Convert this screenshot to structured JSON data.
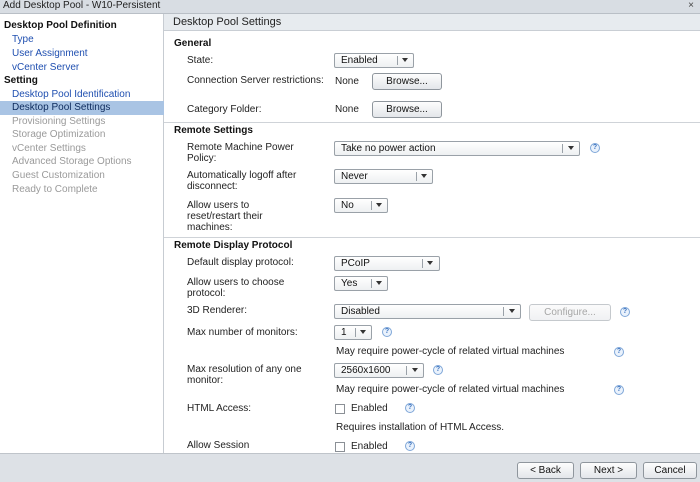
{
  "window": {
    "title": "Add Desktop Pool - W10-Persistent",
    "close": "×"
  },
  "sidebar": {
    "items": [
      {
        "label": "Desktop Pool Definition",
        "kind": "head"
      },
      {
        "label": "Type",
        "kind": "link"
      },
      {
        "label": "User Assignment",
        "kind": "link"
      },
      {
        "label": "vCenter Server",
        "kind": "link"
      },
      {
        "label": "Setting",
        "kind": "head"
      },
      {
        "label": "Desktop Pool Identification",
        "kind": "link"
      },
      {
        "label": "Desktop Pool Settings",
        "kind": "active"
      },
      {
        "label": "Provisioning Settings",
        "kind": "disabled"
      },
      {
        "label": "Storage Optimization",
        "kind": "disabled"
      },
      {
        "label": "vCenter Settings",
        "kind": "disabled"
      },
      {
        "label": "Advanced Storage Options",
        "kind": "disabled"
      },
      {
        "label": "Guest Customization",
        "kind": "disabled"
      },
      {
        "label": "Ready to Complete",
        "kind": "disabled"
      }
    ]
  },
  "main": {
    "header": "Desktop Pool Settings",
    "general": {
      "title": "General",
      "state_label": "State:",
      "state_value": "Enabled",
      "conn_label": "Connection Server restrictions:",
      "conn_value": "None",
      "category_label": "Category Folder:",
      "category_value": "None",
      "browse": "Browse..."
    },
    "remote": {
      "title": "Remote Settings",
      "power_label": "Remote Machine Power Policy:",
      "power_value": "Take no power action",
      "logoff_label": "Automatically logoff after disconnect:",
      "logoff_value": "Never",
      "reset_label": "Allow users to reset/restart their machines:",
      "reset_value": "No"
    },
    "display": {
      "title": "Remote Display Protocol",
      "default_label": "Default display protocol:",
      "default_value": "PCoIP",
      "choose_label": "Allow users to choose protocol:",
      "choose_value": "Yes",
      "renderer_label": "3D Renderer:",
      "renderer_value": "Disabled",
      "configure": "Configure...",
      "monitors_label": "Max number of monitors:",
      "monitors_value": "1",
      "power_cycle_note": "May require power-cycle of related virtual machines",
      "resolution_label": "Max resolution of any one monitor:",
      "resolution_value": "2560x1600",
      "html_label": "HTML Access:",
      "enabled": "Enabled",
      "html_note": "Requires installation of HTML Access.",
      "session_label": "Allow Session"
    }
  },
  "footer": {
    "back": "< Back",
    "next": "Next >",
    "cancel": "Cancel"
  },
  "colors": {
    "accent": "#a9c4e4",
    "link": "#1f4fb0",
    "disabled_text": "#9a9a9a"
  },
  "icons": {
    "help": "help-circle-icon",
    "dropdown": "chevron-down-icon"
  }
}
